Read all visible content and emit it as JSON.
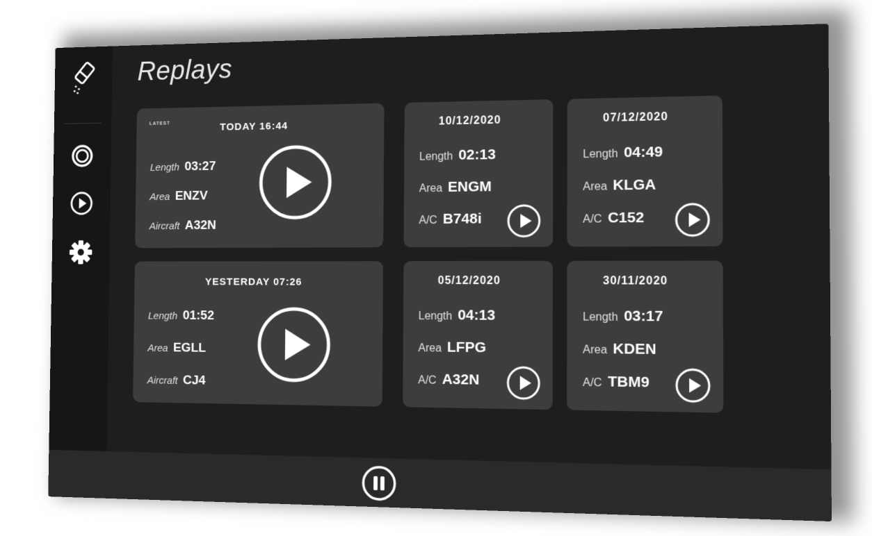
{
  "page": {
    "title": "Replays"
  },
  "sidebar": {
    "items": [
      {
        "icon": "eraser-icon",
        "label": "Clear"
      },
      {
        "icon": "record-icon",
        "label": "Record"
      },
      {
        "icon": "play-icon",
        "label": "Replays"
      },
      {
        "icon": "gear-icon",
        "label": "Settings"
      }
    ]
  },
  "replays": {
    "latest_tag": "LATEST",
    "featured": [
      {
        "title": "TODAY 16:44",
        "length_label": "Length",
        "length": "03:27",
        "area_label": "Area",
        "area": "ENZV",
        "aircraft_label": "Aircraft",
        "aircraft": "A32N"
      },
      {
        "title": "YESTERDAY 07:26",
        "length_label": "Length",
        "length": "01:52",
        "area_label": "Area",
        "area": "EGLL",
        "aircraft_label": "Aircraft",
        "aircraft": "CJ4"
      }
    ],
    "cards": [
      {
        "title": "10/12/2020",
        "length_label": "Length",
        "length": "02:13",
        "area_label": "Area",
        "area": "ENGM",
        "aircraft_label": "A/C",
        "aircraft": "B748i"
      },
      {
        "title": "07/12/2020",
        "length_label": "Length",
        "length": "04:49",
        "area_label": "Area",
        "area": "KLGA",
        "aircraft_label": "A/C",
        "aircraft": "C152"
      },
      {
        "title": "05/12/2020",
        "length_label": "Length",
        "length": "04:13",
        "area_label": "Area",
        "area": "LFPG",
        "aircraft_label": "A/C",
        "aircraft": "A32N"
      },
      {
        "title": "30/11/2020",
        "length_label": "Length",
        "length": "03:17",
        "area_label": "Area",
        "area": "KDEN",
        "aircraft_label": "A/C",
        "aircraft": "TBM9"
      }
    ]
  },
  "bottombar": {
    "pause_icon": "pause-icon"
  },
  "colors": {
    "screen": "#1e1e1e",
    "sidebar": "#161616",
    "card": "#3d3d3d",
    "bottombar": "#2a2a2a",
    "accent": "#ffffff"
  }
}
